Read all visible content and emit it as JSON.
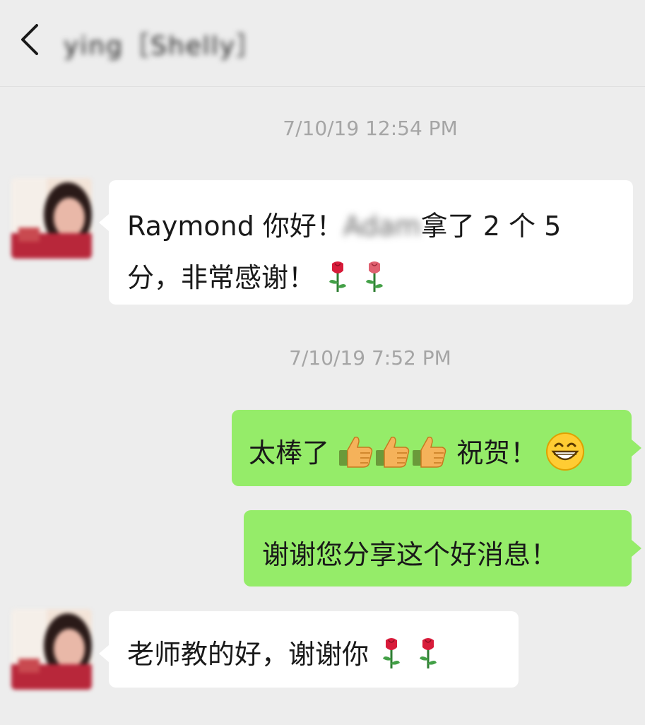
{
  "header": {
    "back_icon": "chevron-left-icon",
    "title": "ying［Shelly］"
  },
  "messages": [
    {
      "type": "timestamp",
      "text": "7/10/19 12:54 PM"
    },
    {
      "type": "incoming",
      "line1_prefix": "Raymond 你好！",
      "redacted_name": "Adam",
      "line1_suffix": "拿了 2 个 5",
      "line2": "分，非常感谢！",
      "emoji": [
        "rose-icon",
        "rose-icon"
      ]
    },
    {
      "type": "timestamp",
      "text": "7/10/19 7:52 PM"
    },
    {
      "type": "outgoing",
      "prefix": "太棒了",
      "thumbs": [
        "thumbs-up-icon",
        "thumbs-up-icon",
        "thumbs-up-icon"
      ],
      "suffix": "祝贺！",
      "emoji": "grinning-face-icon"
    },
    {
      "type": "outgoing",
      "text": "谢谢您分享这个好消息！"
    },
    {
      "type": "incoming",
      "text": "老师教的好，谢谢你",
      "emoji": [
        "rose-icon",
        "rose-icon"
      ]
    }
  ],
  "colors": {
    "background": "#ededed",
    "incoming_bubble": "#ffffff",
    "outgoing_bubble": "#95ec69",
    "timestamp": "#a5a5a5",
    "text": "#191919"
  }
}
